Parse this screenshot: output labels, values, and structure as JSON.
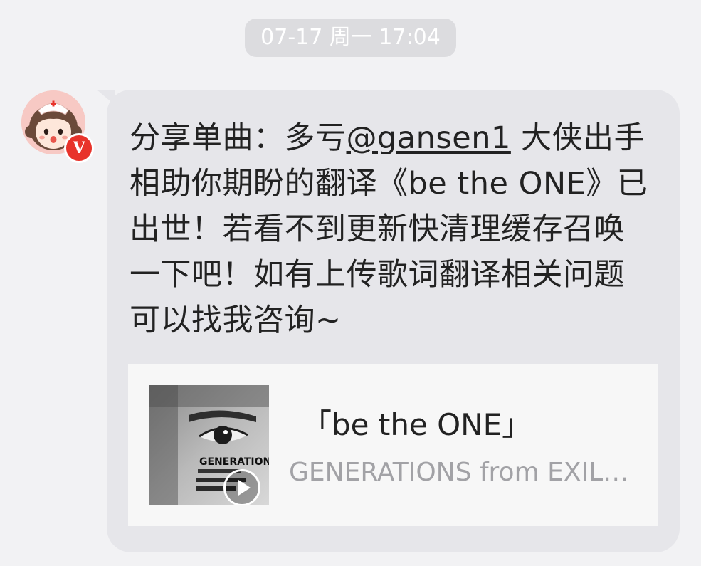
{
  "timestamp": "07-17 周一 17:04",
  "sender": {
    "avatar_icon": "nurse-girl-avatar-icon",
    "badge_label": "V",
    "badge_color": "#e8332b"
  },
  "message": {
    "prefix": "分享单曲：多亏",
    "mention": "@gansen1",
    "body": " 大侠出手相助你期盼的翻译《be the ONE》已出世！若看不到更新快清理缓存召唤一下吧！如有上传歌词翻译相关问题可以找我咨询~"
  },
  "share_card": {
    "title": "「be the ONE」",
    "artist": "GENERATIONS from EXILE TRIBE",
    "album_art_text": "GENERATIONS",
    "play_icon": "play-icon"
  },
  "colors": {
    "background": "#f2f2f4",
    "bubble": "#e6e6ea",
    "card": "#f7f7f7",
    "secondary_text": "#a2a2a6"
  }
}
